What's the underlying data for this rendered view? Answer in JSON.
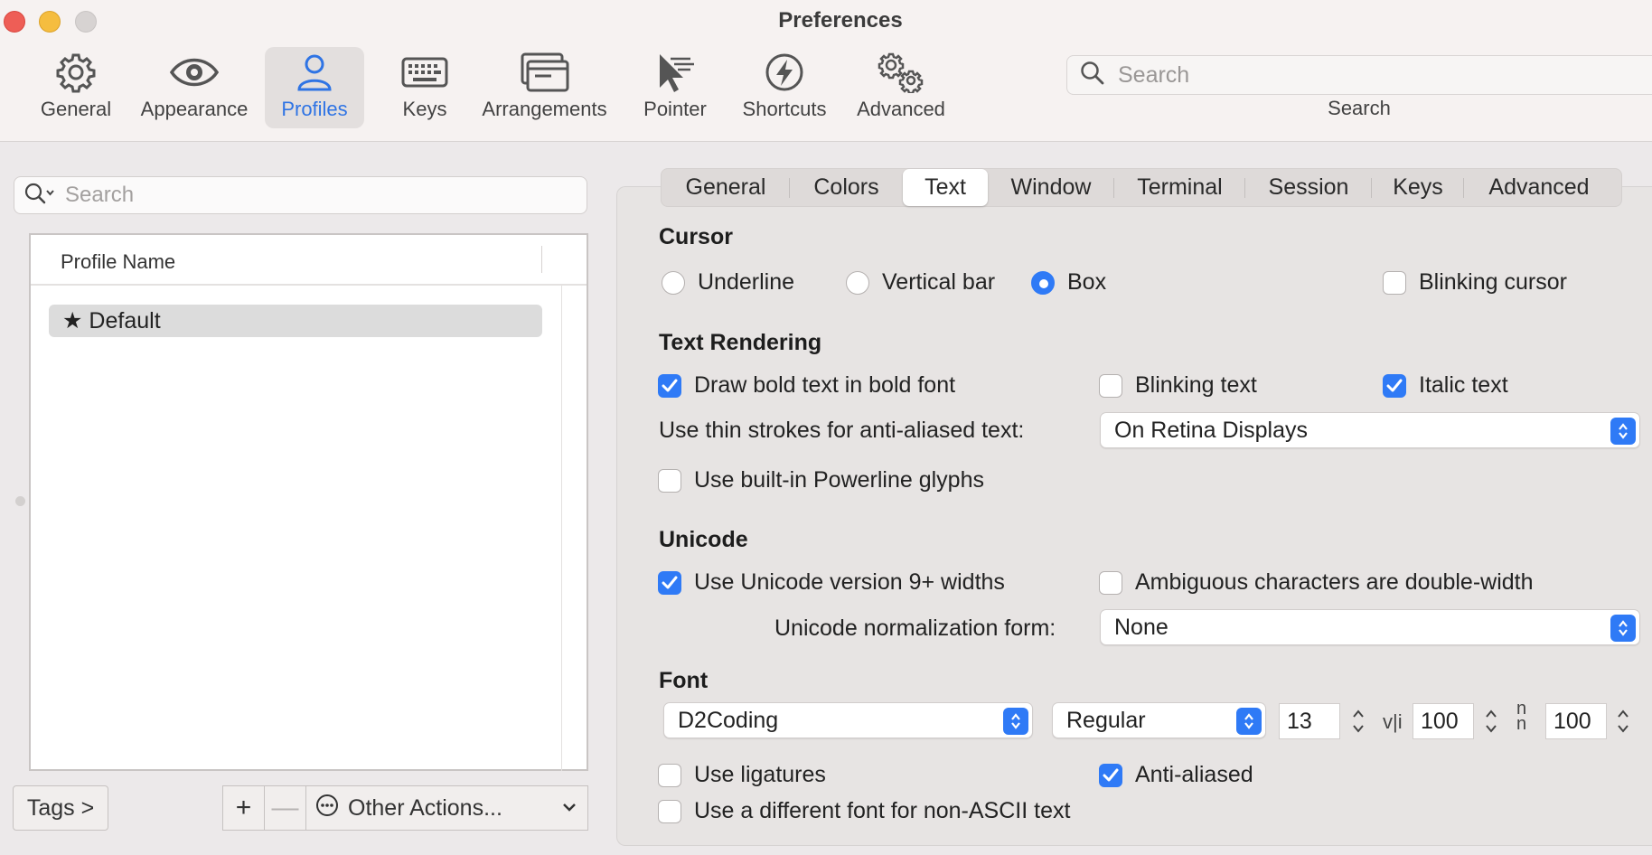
{
  "window": {
    "title": "Preferences"
  },
  "toolbar": {
    "items": [
      {
        "label": "General",
        "icon": "gear-icon"
      },
      {
        "label": "Appearance",
        "icon": "eye-icon"
      },
      {
        "label": "Profiles",
        "icon": "person-icon",
        "active": true
      },
      {
        "label": "Keys",
        "icon": "keyboard-icon"
      },
      {
        "label": "Arrangements",
        "icon": "windows-icon"
      },
      {
        "label": "Pointer",
        "icon": "pointer-icon"
      },
      {
        "label": "Shortcuts",
        "icon": "lightning-icon"
      },
      {
        "label": "Advanced",
        "icon": "gears-icon"
      }
    ],
    "search": {
      "placeholder": "Search",
      "label": "Search"
    }
  },
  "profiles_panel": {
    "search_placeholder": "Search",
    "column_header": "Profile Name",
    "profiles": [
      {
        "name": "Default",
        "is_default": true
      }
    ],
    "tags_button": "Tags >",
    "add_button": "+",
    "remove_button": "—",
    "other_actions": "Other Actions..."
  },
  "tabs": [
    "General",
    "Colors",
    "Text",
    "Window",
    "Terminal",
    "Session",
    "Keys",
    "Advanced"
  ],
  "active_tab": "Text",
  "cursor": {
    "title": "Cursor",
    "underline": "Underline",
    "vertical_bar": "Vertical bar",
    "box": "Box",
    "selected": "Box",
    "blinking_cursor": "Blinking cursor",
    "blinking_cursor_checked": false
  },
  "text_rendering": {
    "title": "Text Rendering",
    "draw_bold": "Draw bold text in bold font",
    "draw_bold_checked": true,
    "blinking_text": "Blinking text",
    "blinking_text_checked": false,
    "italic_text": "Italic text",
    "italic_text_checked": true,
    "thin_strokes_label": "Use thin strokes for anti-aliased text:",
    "thin_strokes_value": "On Retina Displays",
    "powerline": "Use built-in Powerline glyphs",
    "powerline_checked": false
  },
  "unicode": {
    "title": "Unicode",
    "v9_widths": "Use Unicode version 9+ widths",
    "v9_widths_checked": true,
    "ambiguous": "Ambiguous characters are double-width",
    "ambiguous_checked": false,
    "normalization_label": "Unicode normalization form:",
    "normalization_value": "None"
  },
  "font": {
    "title": "Font",
    "family": "D2Coding",
    "style": "Regular",
    "size": "13",
    "horizontal_spacing_icon": "v|i",
    "horizontal_spacing": "100",
    "vertical_spacing_icon": "n/n",
    "vertical_spacing": "100",
    "ligatures": "Use ligatures",
    "ligatures_checked": false,
    "anti_aliased": "Anti-aliased",
    "anti_aliased_checked": true,
    "non_ascii": "Use a different font for non-ASCII text",
    "non_ascii_checked": false
  },
  "colors": {
    "accent": "#2f7af6",
    "active_toolbar_label": "#2f74e4"
  }
}
